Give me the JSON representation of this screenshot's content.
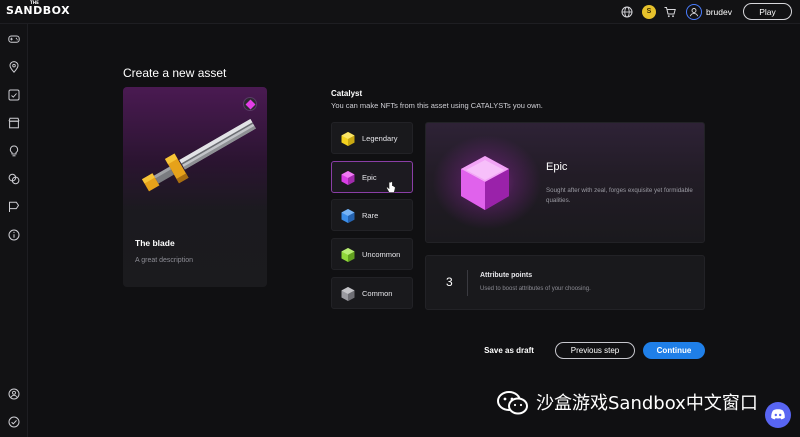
{
  "header": {
    "logo": "SANDBOX",
    "logo_small": "THE",
    "coin_symbol": "S",
    "username": "brudev",
    "play_label": "Play",
    "icons": [
      "globe-icon",
      "sand-coin-icon",
      "cart-icon",
      "user-icon"
    ]
  },
  "sidebar": {
    "icons": [
      "gamepad-icon",
      "map-pin-icon",
      "portfolio-icon",
      "shop-icon",
      "bulb-icon",
      "exchange-icon",
      "flag-icon",
      "info-icon",
      "settings-user-icon",
      "check-circle-icon"
    ]
  },
  "page": {
    "title": "Create a new asset"
  },
  "asset": {
    "name": "The blade",
    "description": "A great description",
    "rarity_color": "#e23ee6"
  },
  "catalyst": {
    "title": "Catalyst",
    "subtitle": "You can make NFTs from this asset using CATALYSTs you own.",
    "options": [
      {
        "label": "Legendary",
        "color": "#f4d21f",
        "icon": "legendary-cube-icon"
      },
      {
        "label": "Epic",
        "color": "#d93ee6",
        "icon": "epic-cube-icon",
        "selected": true
      },
      {
        "label": "Rare",
        "color": "#3b8de8",
        "icon": "rare-cube-icon"
      },
      {
        "label": "Uncommon",
        "color": "#8fd63a",
        "icon": "uncommon-cube-icon"
      },
      {
        "label": "Common",
        "color": "#9a9aa0",
        "icon": "common-cube-icon"
      }
    ]
  },
  "detail": {
    "name": "Epic",
    "description": "Sought after with zeal, forges exquisite yet formidable qualities."
  },
  "attributes": {
    "value": "3",
    "title": "Attribute points",
    "description": "Used to boost attributes of your choosing."
  },
  "actions": {
    "draft": "Save as draft",
    "previous": "Previous step",
    "continue": "Continue"
  },
  "watermark": {
    "text": "沙盒游戏Sandbox中文窗口"
  },
  "colors": {
    "accent": "#1f7fe8",
    "epic": "#d93ee6",
    "background": "#101012"
  }
}
